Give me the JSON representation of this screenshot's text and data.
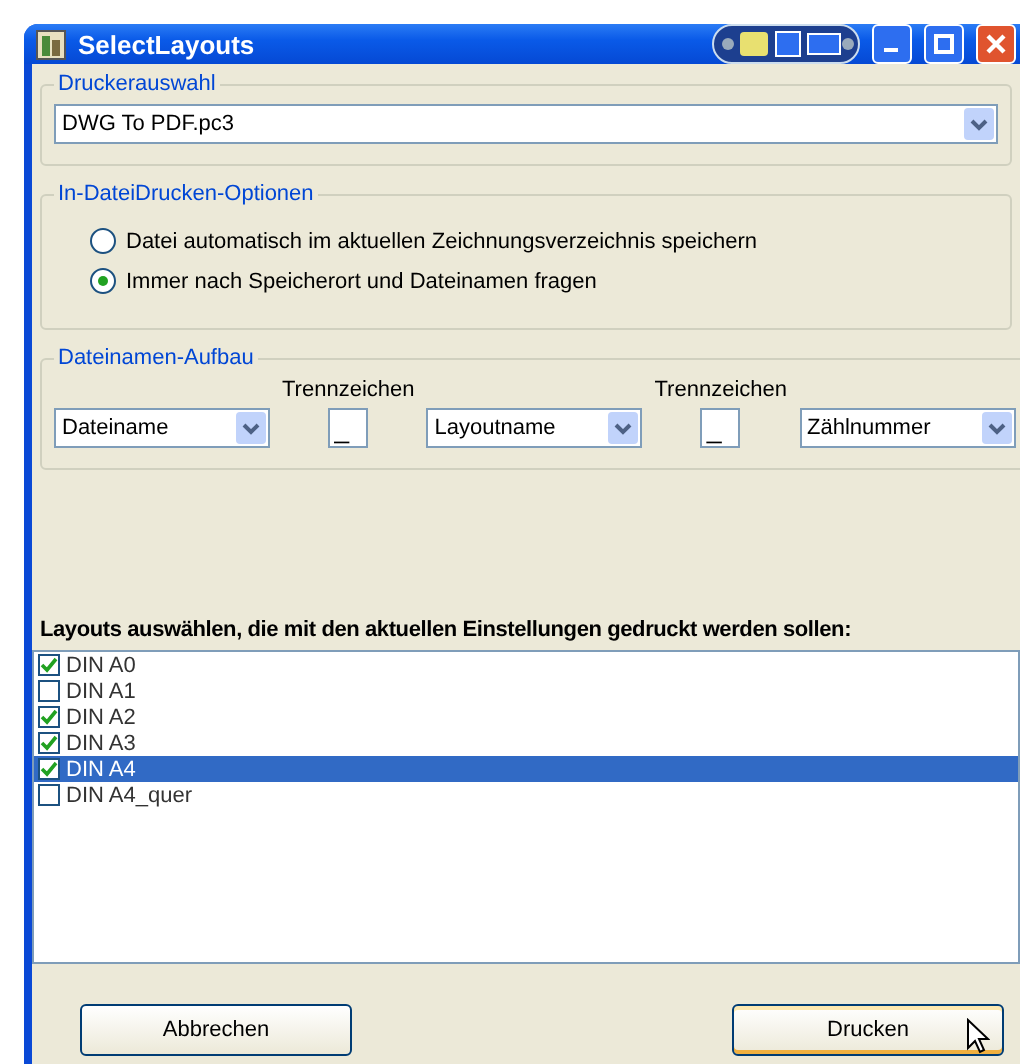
{
  "window": {
    "title": "SelectLayouts"
  },
  "printer_group": {
    "title": "Druckerauswahl",
    "printer": "DWG To PDF.pc3"
  },
  "options_group": {
    "title": "In-DateiDrucken-Optionen",
    "radios": [
      {
        "label": "Datei automatisch im aktuellen Zeichnungsverzeichnis speichern",
        "selected": false
      },
      {
        "label": "Immer nach Speicherort und Dateinamen fragen",
        "selected": true
      }
    ]
  },
  "filename_group": {
    "title": "Dateinamen-Aufbau",
    "parts": [
      {
        "kind": "combo",
        "value": "Dateiname"
      },
      {
        "kind": "separator",
        "heading": "Trennzeichen",
        "value": "_"
      },
      {
        "kind": "combo",
        "value": "Layoutname"
      },
      {
        "kind": "separator",
        "heading": "Trennzeichen",
        "value": "_"
      },
      {
        "kind": "combo",
        "value": "Zählnummer"
      }
    ]
  },
  "layouts_label": "Layouts auswählen, die mit den aktuellen Einstellungen gedruckt werden sollen:",
  "layouts": [
    {
      "name": "DIN A0",
      "checked": true,
      "selected": false
    },
    {
      "name": "DIN A1",
      "checked": false,
      "selected": false
    },
    {
      "name": "DIN A2",
      "checked": true,
      "selected": false
    },
    {
      "name": "DIN A3",
      "checked": true,
      "selected": false
    },
    {
      "name": "DIN A4",
      "checked": true,
      "selected": true
    },
    {
      "name": "DIN A4_quer",
      "checked": false,
      "selected": false
    }
  ],
  "buttons": [
    {
      "label": "Abbrechen",
      "default": false
    },
    {
      "label": "Drucken",
      "default": true
    }
  ]
}
